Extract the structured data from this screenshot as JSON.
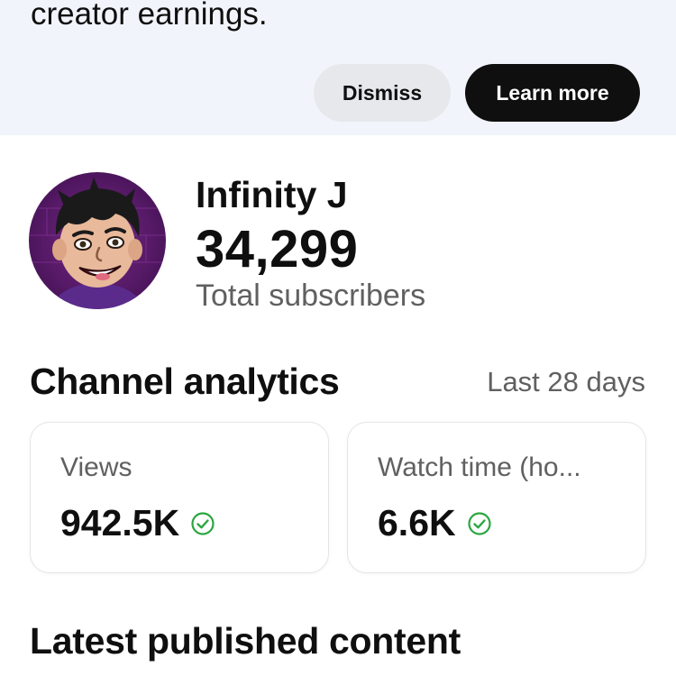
{
  "banner": {
    "text": "creator earnings.",
    "dismiss_label": "Dismiss",
    "learn_more_label": "Learn more"
  },
  "channel": {
    "name": "Infinity J",
    "subscriber_count": "34,299",
    "subscriber_label": "Total subscribers"
  },
  "analytics": {
    "title": "Channel analytics",
    "period": "Last 28 days",
    "cards": [
      {
        "label": "Views",
        "value": "942.5K",
        "icon": "check-circle-icon"
      },
      {
        "label": "Watch time (ho...",
        "value": "6.6K",
        "icon": "check-circle-icon"
      }
    ]
  },
  "latest": {
    "title": "Latest published content"
  },
  "colors": {
    "banner_bg": "#f1f5fb",
    "primary_button": "#0f0f0f",
    "secondary_button": "#e6e8ec",
    "check_green": "#2ba640",
    "secondary_text": "#606060"
  }
}
